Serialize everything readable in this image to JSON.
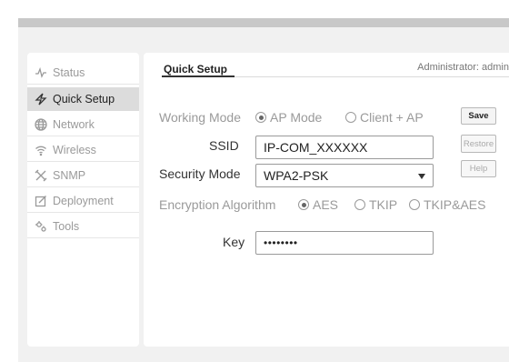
{
  "header": {
    "tab_title": "Quick Setup",
    "admin_label": "Administrator: admin"
  },
  "sidebar": {
    "items": [
      {
        "label": "Status",
        "icon": "pulse-icon"
      },
      {
        "label": "Quick Setup",
        "icon": "lightning-icon",
        "active": true
      },
      {
        "label": "Network",
        "icon": "globe-icon"
      },
      {
        "label": "Wireless",
        "icon": "wifi-icon"
      },
      {
        "label": "SNMP",
        "icon": "tools-cross-icon"
      },
      {
        "label": "Deployment",
        "icon": "edit-icon"
      },
      {
        "label": "Tools",
        "icon": "gear-icon"
      }
    ]
  },
  "form": {
    "working_mode": {
      "label": "Working Mode",
      "options": [
        "AP Mode",
        "Client + AP"
      ],
      "selected": "AP Mode"
    },
    "ssid": {
      "label": "SSID",
      "value": "IP-COM_XXXXXX"
    },
    "security_mode": {
      "label": "Security Mode",
      "value": "WPA2-PSK"
    },
    "encryption": {
      "label": "Encryption Algorithm",
      "options": [
        "AES",
        "TKIP",
        "TKIP&AES"
      ],
      "selected": "AES"
    },
    "key": {
      "label": "Key",
      "value": "••••••••"
    }
  },
  "buttons": {
    "save": "Save",
    "restore": "Restore",
    "help": "Help"
  }
}
